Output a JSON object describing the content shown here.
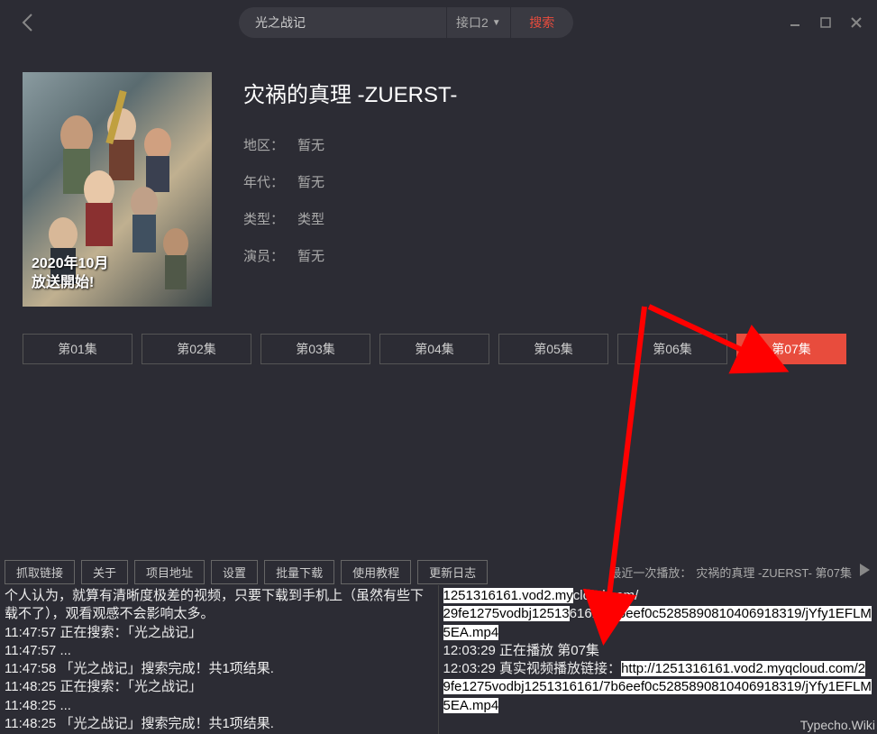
{
  "search": {
    "value": "光之战记",
    "interface": "接口2",
    "button": "搜索"
  },
  "media": {
    "title": "灾祸的真理 -ZUERST-",
    "poster_tag_line1": "2020年10月",
    "poster_tag_line2": "放送開始!",
    "info": [
      {
        "label": "地区：",
        "value": "暂无"
      },
      {
        "label": "年代：",
        "value": "暂无"
      },
      {
        "label": "类型：",
        "value": "类型"
      },
      {
        "label": "演员：",
        "value": "暂无"
      }
    ]
  },
  "episodes": [
    "第01集",
    "第02集",
    "第03集",
    "第04集",
    "第05集",
    "第06集",
    "第07集"
  ],
  "active_episode": 6,
  "toolbar": [
    "抓取链接",
    "关于",
    "项目地址",
    "设置",
    "批量下载",
    "使用教程",
    "更新日志"
  ],
  "last_played": {
    "label": "最近一次播放：",
    "value": "灾祸的真理 -ZUERST-  第07集"
  },
  "log_left": [
    "个人认为，就算有清晰度极差的视频，只要下载到手机上（虽然有些下载不了），观看观感不会影响太多。",
    "11:47:57 正在搜索：「光之战记」",
    "11:47:57 ...",
    "11:47:58 「光之战记」搜索完成！共1项结果.",
    "11:48:25 正在搜索：「光之战记」",
    "11:48:25 ...",
    "11:48:25 「光之战记」搜索完成！共1项结果."
  ],
  "log_right": {
    "line1_pre": "",
    "line1_hl": "1251316161.vod2.my",
    "line1_post": "cloud.com/",
    "line2_hl": "29fe1275vodbj12513",
    "line2_mid": "6161/",
    "line2_hl2": "7b6eef0c5285890810406918319/jYfy1EFLM5EA.mp4",
    "line3": "12:03:29 正在播放   第07集",
    "line4_pre": "12:03:29 真实视频播放链接：",
    "line4_hl": "http://1251316161.vod2.myqcloud.com/29fe1275vodbj1251316161/7b6eef0c5285890810406918319/jYfy1EFLM5EA.mp4"
  },
  "watermark": "Typecho.Wiki"
}
